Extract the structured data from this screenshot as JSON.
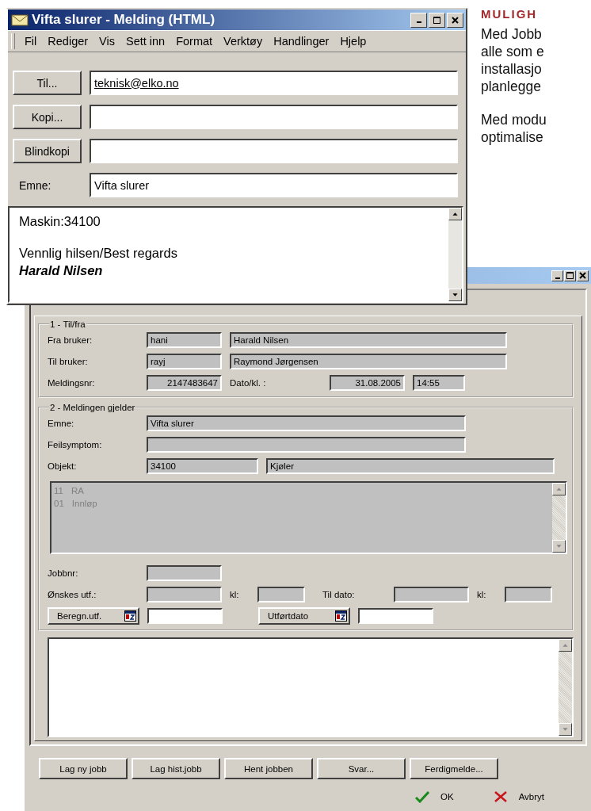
{
  "page_text": {
    "heading": "MULIGH",
    "paragraphs": [
      [
        "Med Jobb",
        "alle som e",
        "installasjo",
        "planlegge"
      ],
      [
        "Med modu",
        "optimalise"
      ]
    ]
  },
  "message_window": {
    "title": "Vifta slurer - Melding (HTML)",
    "menu": [
      "Fil",
      "Rediger",
      "Vis",
      "Sett inn",
      "Format",
      "Verktøy",
      "Handlinger",
      "Hjelp"
    ],
    "header_fields": [
      {
        "kind": "button",
        "label": "Til...",
        "value": "teknisk@elko.no",
        "underlined": true
      },
      {
        "kind": "button",
        "label": "Kopi..."
      },
      {
        "kind": "button",
        "label": "Blindkopi"
      },
      {
        "kind": "label",
        "label": "Emne:",
        "value": "Vifta slurer",
        "underlined": false
      }
    ],
    "body": [
      [
        {
          "kind": "plain",
          "text": "Maskin:34100"
        }
      ],
      [
        {
          "kind": "plain",
          "text": "Vennlig hilsen/Best regards"
        },
        {
          "kind": "signature",
          "text": "Harald Nilsen"
        }
      ]
    ]
  },
  "job_dialog": {
    "groups": [
      {
        "title": "1 - Til/fra",
        "rows": [
          {
            "items": [
              {
                "kind": "label",
                "text": "Fra bruker:"
              },
              {
                "kind": "field",
                "editable": false,
                "value": "hani"
              },
              {
                "kind": "field",
                "editable": false,
                "value": "Harald Nilsen"
              }
            ]
          },
          {
            "items": [
              {
                "kind": "label",
                "text": "Til bruker:"
              },
              {
                "kind": "field",
                "editable": false,
                "value": "rayj"
              },
              {
                "kind": "field",
                "editable": false,
                "value": "Raymond Jørgensen"
              }
            ]
          },
          {
            "items": [
              {
                "kind": "label",
                "text": "Meldingsnr:"
              },
              {
                "kind": "field",
                "editable": false,
                "numeric": true,
                "value": "2147483647"
              },
              {
                "kind": "label",
                "text": "Dato/kl. :"
              },
              {
                "kind": "field",
                "editable": false,
                "numeric": true,
                "value": "31.08.2005"
              },
              {
                "kind": "field",
                "editable": false,
                "value": "14:55"
              }
            ]
          }
        ]
      },
      {
        "title": "2 - Meldingen gjelder",
        "rows": [
          {
            "items": [
              {
                "kind": "label",
                "text": "Emne:"
              },
              {
                "kind": "field",
                "editable": false,
                "value": "Vifta slurer"
              }
            ]
          },
          {
            "items": [
              {
                "kind": "label",
                "text": "Feilsymptom:"
              },
              {
                "kind": "field",
                "editable": false
              }
            ]
          },
          {
            "items": [
              {
                "kind": "label",
                "text": "Objekt:"
              },
              {
                "kind": "field",
                "editable": false,
                "value": "34100"
              },
              {
                "kind": "field",
                "editable": false,
                "value": "Kjøler"
              }
            ]
          },
          {
            "items": [
              {
                "kind": "listbox",
                "disabled": true,
                "rows": [
                  {
                    "code": "11",
                    "text": "RA"
                  },
                  {
                    "code": "01",
                    "text": "Innløp"
                  }
                ]
              }
            ]
          },
          {
            "items": [
              {
                "kind": "label",
                "text": "Jobbnr:"
              },
              {
                "kind": "field",
                "editable": false
              }
            ]
          },
          {
            "items": [
              {
                "kind": "label",
                "text": "Ønskes utf.:"
              },
              {
                "kind": "field",
                "editable": false
              },
              {
                "kind": "label",
                "text": "kl:"
              },
              {
                "kind": "field",
                "editable": false
              },
              {
                "kind": "label",
                "text": "Til dato:"
              },
              {
                "kind": "field",
                "editable": false
              },
              {
                "kind": "label",
                "text": "kl:"
              },
              {
                "kind": "field",
                "editable": false
              }
            ]
          },
          {
            "items": [
              {
                "kind": "button",
                "label": "Beregn.utf."
              },
              {
                "kind": "field",
                "editable": true
              },
              {
                "kind": "button",
                "label": "Utførtdato"
              },
              {
                "kind": "field",
                "editable": true
              }
            ]
          }
        ]
      }
    ],
    "actions": [
      "Lag ny jobb",
      "Lag hist.jobb",
      "Hent jobben",
      "Svar...",
      "Ferdigmelde..."
    ],
    "confirm": [
      {
        "kind": "ok",
        "label": "OK"
      },
      {
        "kind": "cancel",
        "label": "Avbryt"
      }
    ]
  }
}
